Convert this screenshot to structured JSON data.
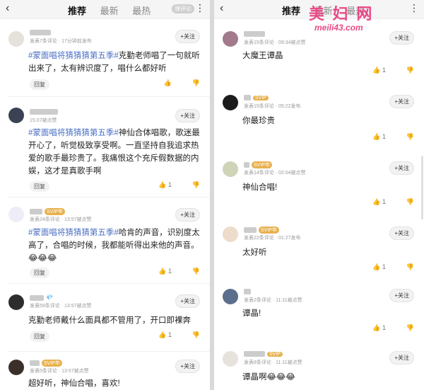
{
  "left": {
    "nav": {
      "back": "‹",
      "tabs": [
        "推荐",
        "最新",
        "最热"
      ],
      "pill": "弹评论",
      "more": "⋮"
    },
    "comments": [
      {
        "meta": "发表7条评论 · 17分钟前发布",
        "follow": "+关注",
        "tag": "#蒙面唱将猜猜猜第五季#",
        "text": "克勤老师唱了一句就听出来了，太有辨识度了，唱什么都好听",
        "reply": "回复",
        "like": "",
        "vip": ""
      },
      {
        "meta": "15.07被点赞",
        "follow": "+关注",
        "tag": "#蒙面唱将猜猜猜第五季#",
        "text": "神仙合体唱歌，歌迷最开心了，听觉极致享受啊。一直坚持自我追求热爱的歌手最珍贵了。我痛恨这个充斥假数据的内娱，这才是真歌手啊",
        "reply": "回复",
        "like": "1",
        "vip": ""
      },
      {
        "meta": "发表24条评论 · 13:57被点赞",
        "follow": "+关注",
        "tag": "#蒙面唱将猜猜猜第五季#",
        "text": "哈肯的声音，识别度太高了，合唱的时候，我都能听得出来他的声音。😂😂😂",
        "reply": "回复",
        "like": "1",
        "vip": "SVIP年"
      },
      {
        "meta": "发表59条评论 · 13:57被点赞",
        "follow": "+关注",
        "tag": "",
        "text": "克勤老师戴什么面具都不管用了，开口即裸奔",
        "reply": "回复",
        "like": "1",
        "vip": "💎"
      },
      {
        "meta": "发表5条评论 · 13:57被点赞",
        "follow": "+关注",
        "tag": "",
        "text": "超好听，神仙合唱，喜欢!",
        "reply": "",
        "like": "",
        "vip": "SVIP年"
      }
    ]
  },
  "right": {
    "nav": {
      "back": "‹",
      "tabs": [
        "推荐",
        "最新",
        "最热"
      ],
      "more": "⋮"
    },
    "watermark": {
      "title": "美 妇 网",
      "url": "meili43.com"
    },
    "comments": [
      {
        "meta": "发表15条评论 · 09:34被点赞",
        "follow": "+关注",
        "text": "大魔王谭晶",
        "like": "1",
        "vip": ""
      },
      {
        "meta": "发表15条评论 · 05:22发布",
        "follow": "+关注",
        "text": "你最珍贵",
        "like": "1",
        "vip": "SVIP"
      },
      {
        "meta": "发表14条评论 · 02:04被点赞",
        "follow": "+关注",
        "text": "神仙合唱!",
        "like": "1",
        "vip": "SVIP年"
      },
      {
        "meta": "发表22条评论 · 01:27发布",
        "follow": "+关注",
        "text": "太好听",
        "like": "1",
        "vip": "SVIP年"
      },
      {
        "meta": "发表2条评论 · 11:11被点赞",
        "follow": "+关注",
        "text": "谭晶!",
        "like": "1",
        "vip": ""
      },
      {
        "meta": "发表8条评论 · 11:11被点赞",
        "follow": "+关注",
        "text": "谭晶啊😂😂😂",
        "like": "",
        "vip": "SVIP"
      }
    ]
  }
}
